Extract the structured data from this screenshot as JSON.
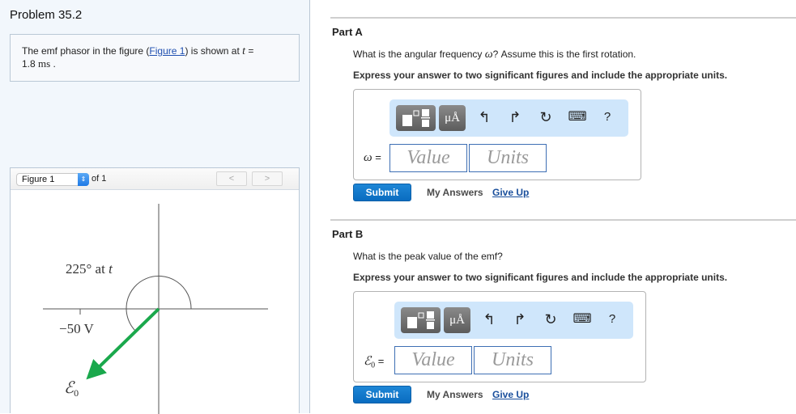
{
  "problem": {
    "title": "Problem 35.2",
    "intro": {
      "text_before_link": "The emf phasor in the figure (",
      "link": "Figure 1",
      "text_after_link": ") is shown at ",
      "variable": "t",
      "equals": " =",
      "value": "1.8",
      "unit": "ms",
      "end": " ."
    }
  },
  "figure_viewer": {
    "selected": "Figure 1",
    "of_label": "of 1",
    "prev_glyph": "<",
    "next_glyph": ">",
    "figure": {
      "angle_label": "225° at ",
      "angle_var": "t",
      "tick_label": "−50 V",
      "phasor_label": "ℰ",
      "phasor_sub": "0",
      "phasor_color": "#1aa84c"
    }
  },
  "toolbar": {
    "templates_icon": "templates-icon",
    "units_label": "μÅ",
    "undo_glyph": "↰",
    "redo_glyph": "↱",
    "reset_glyph": "↻",
    "keyboard_glyph": "⌨",
    "help_glyph": "?"
  },
  "parts": [
    {
      "title": "Part A",
      "question_before": "What is the angular frequency ",
      "question_symbol": "ω",
      "question_after": "? Assume this is the first rotation.",
      "instruction": "Express your answer to two significant figures and include the appropriate units.",
      "label_symbol": "ω",
      "label_sub": "",
      "label_eq": " =",
      "value_placeholder": "Value",
      "units_placeholder": "Units",
      "submit": "Submit",
      "my_answers": "My Answers",
      "give_up": "Give Up"
    },
    {
      "title": "Part B",
      "question_before": "What is the peak value of the emf?",
      "question_symbol": "",
      "question_after": "",
      "instruction": "Express your answer to two significant figures and include the appropriate units.",
      "label_symbol": "ℰ",
      "label_sub": "0",
      "label_eq": " =",
      "value_placeholder": "Value",
      "units_placeholder": "Units",
      "submit": "Submit",
      "my_answers": "My Answers",
      "give_up": "Give Up"
    }
  ]
}
